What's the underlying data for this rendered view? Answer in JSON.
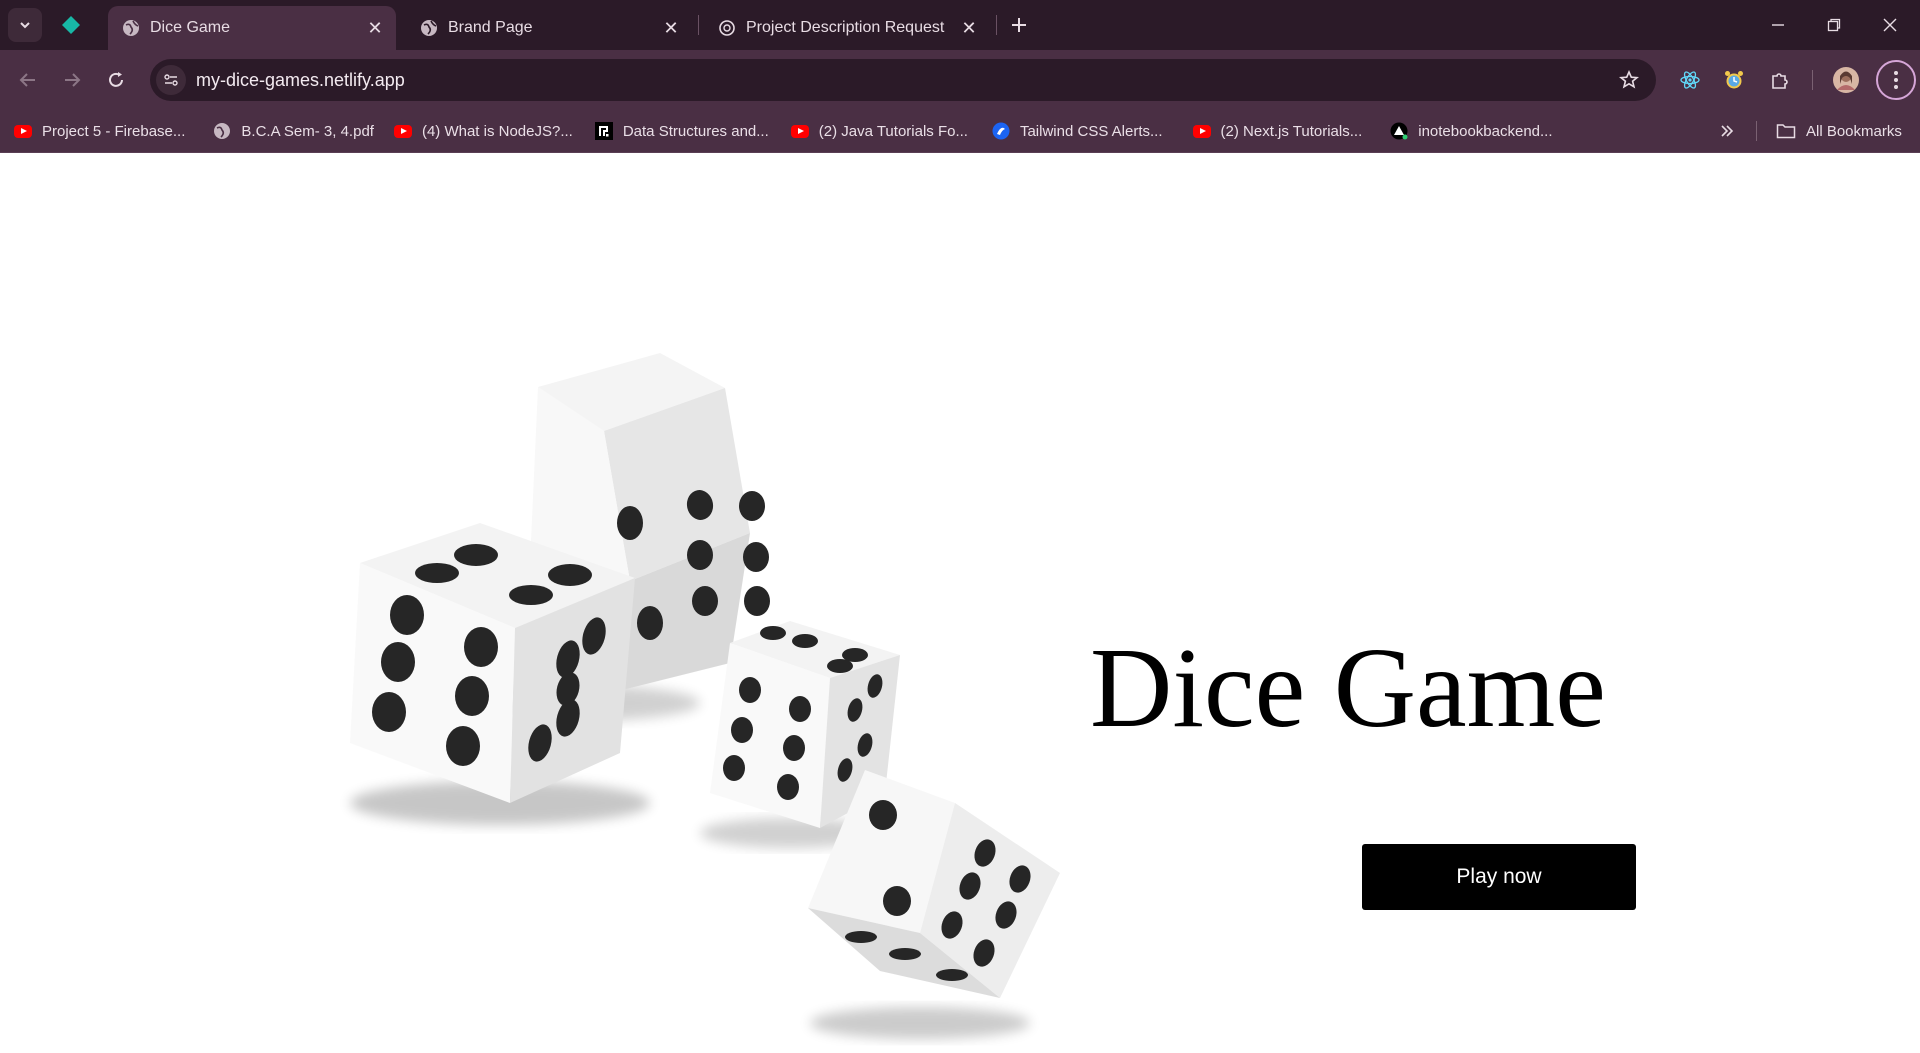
{
  "browser": {
    "tabs": [
      {
        "title": "Dice Game",
        "active": true,
        "icon": "globe-icon"
      },
      {
        "title": "Brand Page",
        "active": false,
        "icon": "globe-icon"
      },
      {
        "title": "Project Description Request",
        "active": false,
        "icon": "openai-icon"
      }
    ],
    "address": {
      "url": "my-dice-games.netlify.app"
    },
    "bookmarks": [
      {
        "label": "Project 5 - Firebase...",
        "icon": "youtube-icon"
      },
      {
        "label": "B.C.A Sem- 3, 4.pdf",
        "icon": "globe-icon"
      },
      {
        "label": "(4) What is NodeJS?...",
        "icon": "youtube-icon"
      },
      {
        "label": "Data Structures and...",
        "icon": "site-icon"
      },
      {
        "label": "(2) Java Tutorials Fo...",
        "icon": "youtube-icon"
      },
      {
        "label": "Tailwind CSS Alerts...",
        "icon": "flowbite-icon"
      },
      {
        "label": "(2) Next.js Tutorials...",
        "icon": "youtube-icon"
      },
      {
        "label": "inotebookbackend...",
        "icon": "render-icon"
      }
    ],
    "all_bookmarks_label": "All Bookmarks",
    "colors": {
      "frame": "#2b1a28",
      "toolbar": "#4a2f44"
    }
  },
  "page": {
    "title": "Dice Game",
    "play_button": "Play now"
  }
}
